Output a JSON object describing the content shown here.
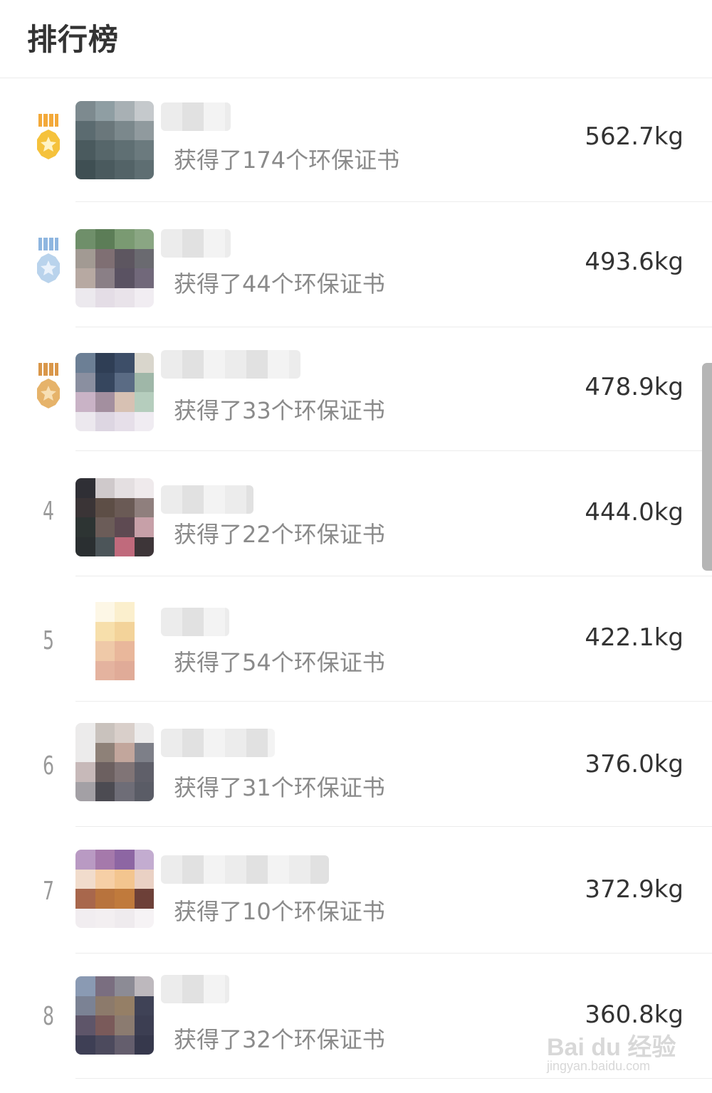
{
  "header": {
    "title": "排行榜"
  },
  "rankings": [
    {
      "rank": "",
      "medal": "gold-medal-icon",
      "certificates": "获得了174个环保证书",
      "weight": "562.7kg"
    },
    {
      "rank": "",
      "medal": "silver-medal-icon",
      "certificates": "获得了44个环保证书",
      "weight": "493.6kg"
    },
    {
      "rank": "",
      "medal": "bronze-medal-icon",
      "certificates": "获得了33个环保证书",
      "weight": "478.9kg"
    },
    {
      "rank": "4",
      "medal": "",
      "certificates": "获得了22个环保证书",
      "weight": "444.0kg"
    },
    {
      "rank": "5",
      "medal": "",
      "certificates": "获得了54个环保证书",
      "weight": "422.1kg"
    },
    {
      "rank": "6",
      "medal": "",
      "certificates": "获得了31个环保证书",
      "weight": "376.0kg"
    },
    {
      "rank": "7",
      "medal": "",
      "certificates": "获得了10个环保证书",
      "weight": "372.9kg"
    },
    {
      "rank": "8",
      "medal": "",
      "certificates": "获得了32个环保证书",
      "weight": "360.8kg"
    }
  ],
  "watermark": {
    "main": "Bai du 经验",
    "sub": "jingyan.baidu.com"
  },
  "colors": {
    "gold": "#f5c23c",
    "silver": "#b9d3ec",
    "bronze": "#e6b36a",
    "text_gray": "#8a8a8a"
  }
}
